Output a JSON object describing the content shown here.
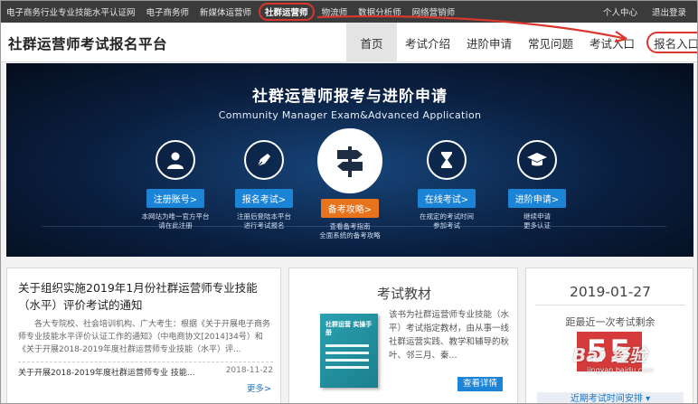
{
  "topbar": {
    "links": [
      "电子商务行业专业技能水平认证网",
      "电子商务师",
      "新媒体运营师",
      "社群运营师",
      "物流师",
      "数据分析师",
      "网络营销师"
    ],
    "active_index": 3,
    "user_center": "个人中心",
    "logout": "退出登录"
  },
  "header": {
    "brand": "社群运营师考试报名平台",
    "nav": [
      "首页",
      "考试介绍",
      "进阶申请",
      "常见问题",
      "考试入口",
      "报名入口"
    ]
  },
  "banner": {
    "title": "社群运营师报考与进阶申请",
    "subtitle": "Community Manager Exam&Advanced Application",
    "steps": [
      {
        "button": "注册账号>",
        "desc_1": "本网站为唯一官方平台",
        "desc_2": "请在此注册",
        "icon": "user-icon"
      },
      {
        "button": "报名考试>",
        "desc_1": "注册后登陆本平台",
        "desc_2": "进行考试报名",
        "icon": "pen-icon"
      },
      {
        "button": "备考攻略>",
        "desc_1": "查看备考指南",
        "desc_2": "全面系统的备考攻略",
        "icon": "signpost-icon"
      },
      {
        "button": "在线考试>",
        "desc_1": "在规定的考试时间",
        "desc_2": "参加考试",
        "icon": "hourglass-icon"
      },
      {
        "button": "进阶申请>",
        "desc_1": "继续申请",
        "desc_2": "更多认证",
        "icon": "graduation-cap-icon"
      }
    ]
  },
  "news": {
    "title": "关于组织实施2019年1月份社群运营师专业技能（水平）评价考试的通知",
    "body": "各大专院校、社会培训机构、广大考生：根据《关于开展电子商务师专业技能水平评价认证工作的通知》（中电商协文[2014]34号）和《关于开展2018-2019年度社群运营师专业技能（水平）评...",
    "row_title": "关于开展2018-2019年度社群运营师专业 技能...",
    "row_date": "2018-11-22",
    "more": "更多>"
  },
  "textbook": {
    "title": "考试教材",
    "book_title": "社群运营 实操手册",
    "blurb": "该书为社群运营师专业技能（水平）考试指定教材，由从事一线社群运营实践、教学和辅导的秋叶、邻三月、秦...",
    "detail_button": "查看详情"
  },
  "countdown": {
    "date": "2019-01-27",
    "label": "距最近一次考试剩余",
    "days": "55",
    "schedule": "近期考试时间安排"
  },
  "watermark": {
    "main": "Bai 经验",
    "sub": "jingyan.baidu.com"
  },
  "colors": {
    "annotation_red": "#d9362e",
    "step_blue": "#1c84d6",
    "step_orange": "#e8731d",
    "countdown_red": "#d63b3b"
  }
}
